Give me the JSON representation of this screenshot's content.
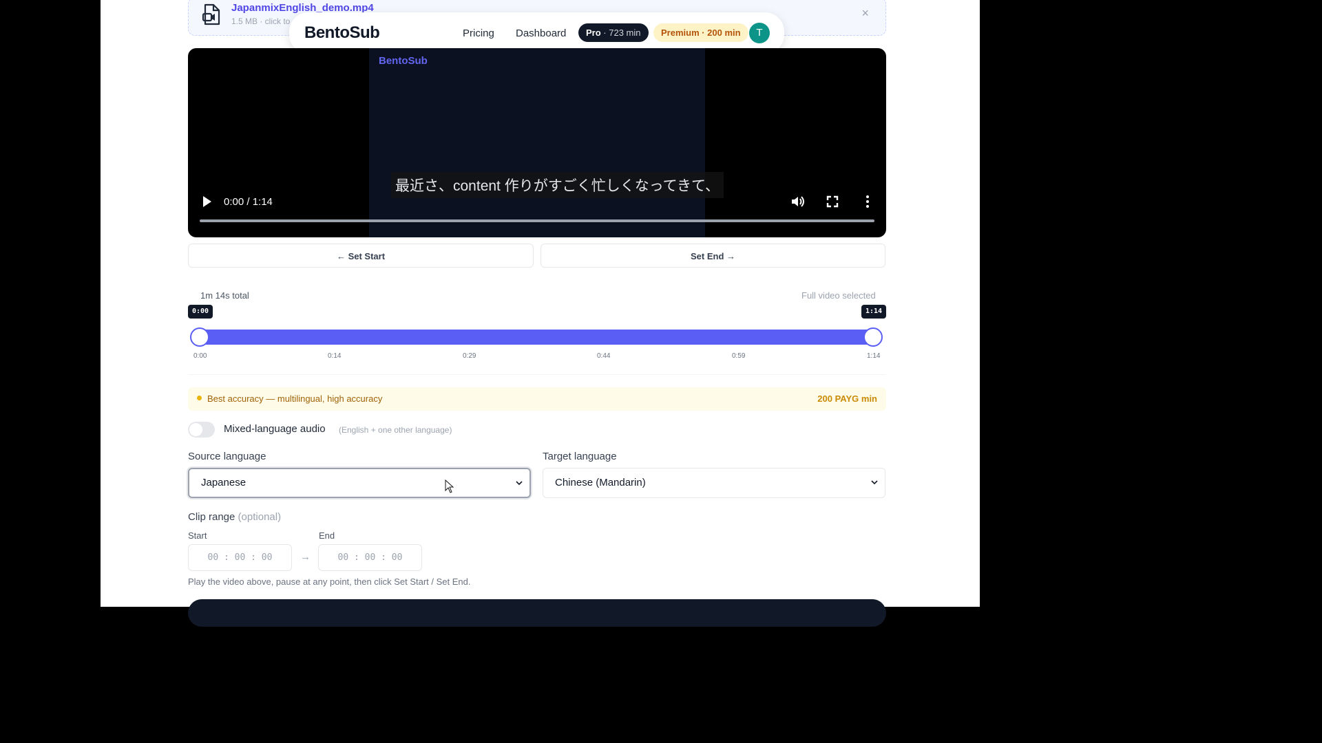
{
  "file": {
    "name": "JapanmixEnglish_demo.mp4",
    "meta": "1.5 MB · click to",
    "close_icon": "×"
  },
  "nav": {
    "brand": "BentoSub",
    "pricing": "Pricing",
    "dashboard": "Dashboard",
    "pro_label": "Pro",
    "pro_minutes": "· 723 min",
    "premium": "Premium · 200 min",
    "avatar_initial": "T"
  },
  "video": {
    "brand": "BentoSub",
    "subtitle": "最近さ、content 作りがすごく忙しくなってきて、",
    "time": "0:00 / 1:14",
    "progress": 0
  },
  "buttons": {
    "set_start": "← Set Start",
    "set_end": "Set End →"
  },
  "timeline": {
    "total": "1m 14s total",
    "status": "Full video selected",
    "start_badge": "0:00",
    "end_badge": "1:14",
    "ticks": [
      "0:00",
      "0:14",
      "0:29",
      "0:44",
      "0:59",
      "1:14"
    ],
    "selection_start": 0,
    "selection_end": 1
  },
  "accuracy": {
    "text": "Best accuracy — multilingual, high accuracy",
    "minutes": "200 PAYG min"
  },
  "mixed": {
    "label": "Mixed-language audio",
    "hint": "(English + one other language)",
    "enabled": false
  },
  "source": {
    "label": "Source language",
    "value": "Japanese"
  },
  "target": {
    "label": "Target language",
    "value": "Chinese (Mandarin)"
  },
  "clip": {
    "title": "Clip range",
    "optional": "(optional)",
    "start_label": "Start",
    "end_label": "End",
    "start_value": "00 : 00 : 00",
    "end_value": "00 : 00 : 00",
    "arrow": "→",
    "help": "Play the video above, pause at any point, then click Set Start / Set End."
  },
  "colors": {
    "accent": "#5b5ef5",
    "pro_pill": "#111827",
    "premium_pill": "#fef3c7",
    "avatar": "#0d9488"
  }
}
